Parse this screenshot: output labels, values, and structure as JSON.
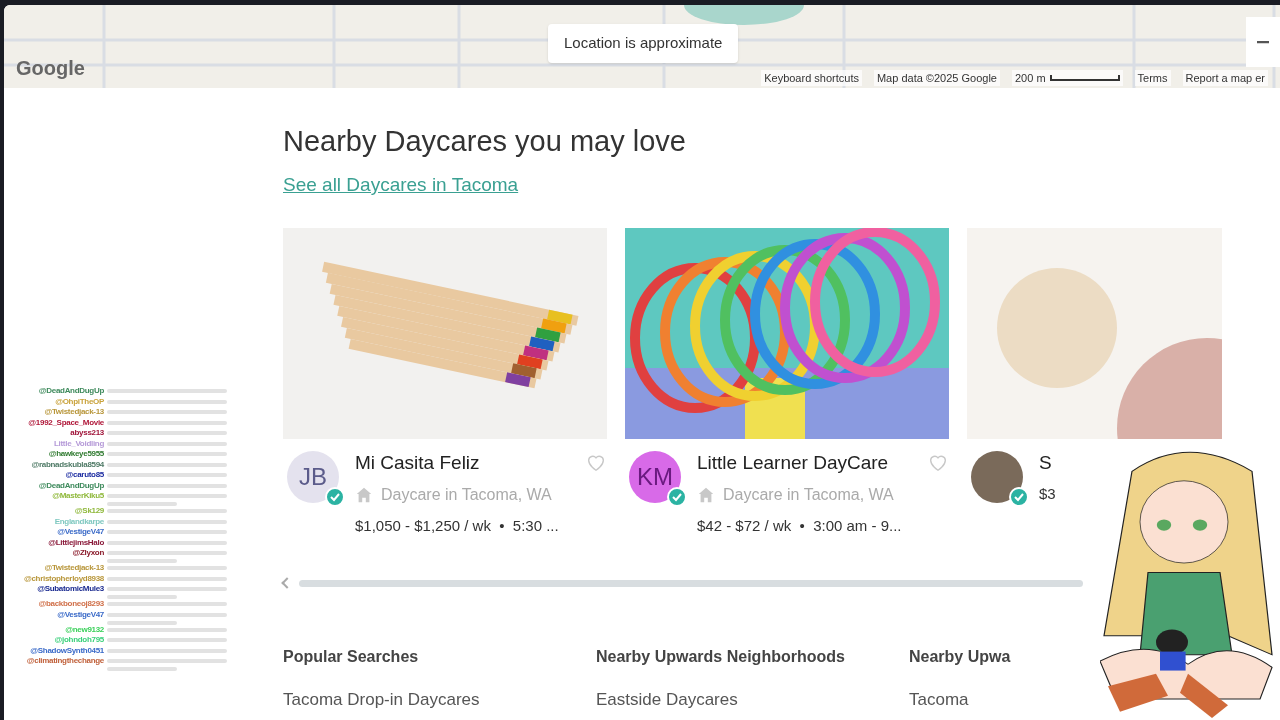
{
  "map": {
    "notice": "Location is approximate",
    "logo": "Google",
    "attribution": [
      "Keyboard shortcuts",
      "Map data ©2025 Google",
      "200 m",
      "Terms",
      "Report a map er"
    ]
  },
  "section": {
    "title": "Nearby Daycares you may love",
    "link": "See all Daycares in Tacoma"
  },
  "cards": [
    {
      "initials": "JB",
      "kind": "initials",
      "color": "#e4e2ee",
      "name": "Mi Casita Feliz",
      "category": "Daycare in Tacoma, WA",
      "details": "$1,050 - $1,250 / wk  •  5:30 ...",
      "favorite": false
    },
    {
      "initials": "KM",
      "kind": "initials",
      "color": "#d86ae8",
      "name": "Little Learner DayCare",
      "category": "Daycare in Tacoma, WA",
      "details": "$42 - $72 / wk  •  3:00 am - 9...",
      "favorite": false
    },
    {
      "kind": "photo",
      "name": "S",
      "details": "$3"
    }
  ],
  "footer_columns": [
    {
      "heading": "Popular Searches",
      "link": "Tacoma Drop-in Daycares"
    },
    {
      "heading": "Nearby Upwards Neighborhoods",
      "link": "Eastside Daycares"
    },
    {
      "heading": "Nearby Upwa",
      "link": "Tacoma"
    }
  ],
  "chat": [
    {
      "user": "@DeadAndDugUp",
      "color": "#3e8a5c",
      "wrapped": false
    },
    {
      "user": "@OhpiTheOP",
      "color": "#c9a23a",
      "wrapped": false
    },
    {
      "user": "@Twistedjack-13",
      "color": "#b8963a",
      "wrapped": false
    },
    {
      "user": "@1992_Space_Movie",
      "color": "#b0183a",
      "wrapped": false
    },
    {
      "user": "abyss213",
      "color": "#a0153a",
      "wrapped": false
    },
    {
      "user": "Little_Voidling",
      "color": "#b59ad8",
      "wrapped": false
    },
    {
      "user": "@hawkeye5955",
      "color": "#2f7a2f",
      "wrapped": false
    },
    {
      "user": "@rabnadskubla8594",
      "color": "#4f7a66",
      "wrapped": false
    },
    {
      "user": "@caruto85",
      "color": "#1a2aa0",
      "wrapped": false
    },
    {
      "user": "@DeadAndDugUp",
      "color": "#3e8a5c",
      "wrapped": false
    },
    {
      "user": "@MasterKiku5",
      "color": "#8fb83a",
      "wrapped": true
    },
    {
      "user": "@Sk129",
      "color": "#8fb83a",
      "wrapped": false
    },
    {
      "user": "Englandkarpe",
      "color": "#7fc8c0",
      "wrapped": false
    },
    {
      "user": "@VestigeV47",
      "color": "#3a6ac8",
      "wrapped": false
    },
    {
      "user": "@LittlejimsHalo",
      "color": "#8a1a3a",
      "wrapped": false
    },
    {
      "user": "@Zlyxon",
      "color": "#8a1a2a",
      "wrapped": true
    },
    {
      "user": "@Twistedjack-13",
      "color": "#b8963a",
      "wrapped": false
    },
    {
      "user": "@christopherloyd8938",
      "color": "#b8963a",
      "wrapped": false
    },
    {
      "user": "@SubatomicMule3",
      "color": "#1a2a90",
      "wrapped": true
    },
    {
      "user": "@backboneoj8293",
      "color": "#d0704a",
      "wrapped": false
    },
    {
      "user": "@VestigeV47",
      "color": "#3a6ac8",
      "wrapped": true
    },
    {
      "user": "@new9132",
      "color": "#3ad05a",
      "wrapped": false
    },
    {
      "user": "@johndoh795",
      "color": "#3ad07a",
      "wrapped": false
    },
    {
      "user": "@ShadowSynth0451",
      "color": "#3a6ac8",
      "wrapped": false
    },
    {
      "user": "@climatingthechange",
      "color": "#c0603a",
      "wrapped": true
    }
  ]
}
